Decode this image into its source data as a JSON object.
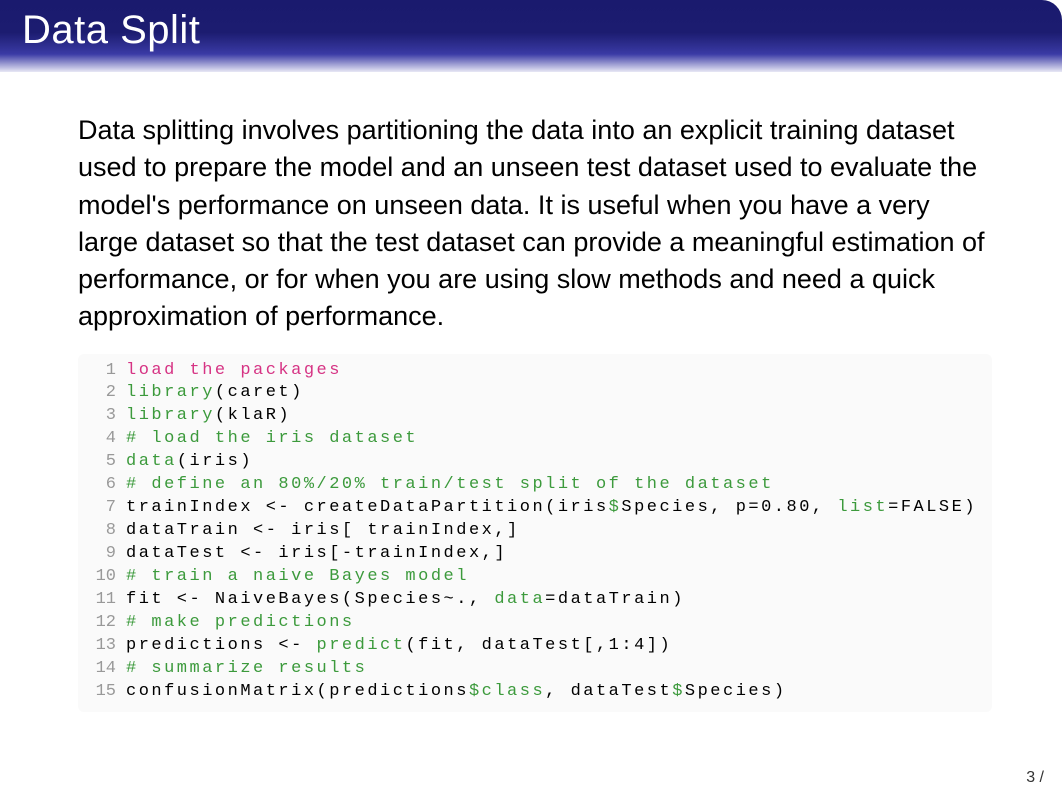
{
  "title": "Data Split",
  "paragraph": "Data splitting involves partitioning the data into an explicit training dataset used to prepare the model and an unseen test dataset used to evaluate the model's performance on unseen data. It is useful when you have a very large dataset so that the test dataset can provide a meaningful estimation of performance, or for when you are using slow methods and need a quick approximation of performance.",
  "code": {
    "lines": [
      {
        "n": "1",
        "segs": [
          {
            "t": "load the packages",
            "c": "c-magenta"
          }
        ]
      },
      {
        "n": "2",
        "segs": [
          {
            "t": "library",
            "c": "c-green"
          },
          {
            "t": "(caret)",
            "c": "c-black"
          }
        ]
      },
      {
        "n": "3",
        "segs": [
          {
            "t": "library",
            "c": "c-green"
          },
          {
            "t": "(klaR)",
            "c": "c-black"
          }
        ]
      },
      {
        "n": "4",
        "segs": [
          {
            "t": "# load the iris dataset",
            "c": "c-green"
          }
        ]
      },
      {
        "n": "5",
        "segs": [
          {
            "t": "data",
            "c": "c-green"
          },
          {
            "t": "(iris)",
            "c": "c-black"
          }
        ]
      },
      {
        "n": "6",
        "segs": [
          {
            "t": "# define an 80%/20% train/test split of the dataset",
            "c": "c-green"
          }
        ]
      },
      {
        "n": "7",
        "segs": [
          {
            "t": "trainIndex <- createDataPartition(iris",
            "c": "c-black"
          },
          {
            "t": "$",
            "c": "c-green"
          },
          {
            "t": "Species, p=0.80, ",
            "c": "c-black"
          },
          {
            "t": "list",
            "c": "c-green"
          },
          {
            "t": "=FALSE)",
            "c": "c-black"
          }
        ]
      },
      {
        "n": "8",
        "segs": [
          {
            "t": "dataTrain <- iris[ trainIndex,]",
            "c": "c-black"
          }
        ]
      },
      {
        "n": "9",
        "segs": [
          {
            "t": "dataTest <- iris[-trainIndex,]",
            "c": "c-black"
          }
        ]
      },
      {
        "n": "10",
        "segs": [
          {
            "t": "# train a naive Bayes model",
            "c": "c-green"
          }
        ]
      },
      {
        "n": "11",
        "segs": [
          {
            "t": "fit <- NaiveBayes(Species~., ",
            "c": "c-black"
          },
          {
            "t": "data",
            "c": "c-green"
          },
          {
            "t": "=dataTrain)",
            "c": "c-black"
          }
        ]
      },
      {
        "n": "12",
        "segs": [
          {
            "t": "# make predictions",
            "c": "c-green"
          }
        ]
      },
      {
        "n": "13",
        "segs": [
          {
            "t": "predictions <- ",
            "c": "c-black"
          },
          {
            "t": "predict",
            "c": "c-green"
          },
          {
            "t": "(fit, dataTest[,1:4])",
            "c": "c-black"
          }
        ]
      },
      {
        "n": "14",
        "segs": [
          {
            "t": "# summarize results",
            "c": "c-green"
          }
        ]
      },
      {
        "n": "15",
        "segs": [
          {
            "t": "confusionMatrix(predictions",
            "c": "c-black"
          },
          {
            "t": "$class",
            "c": "c-green"
          },
          {
            "t": ", dataTest",
            "c": "c-black"
          },
          {
            "t": "$",
            "c": "c-green"
          },
          {
            "t": "Species)",
            "c": "c-black"
          }
        ]
      }
    ]
  },
  "footer": "3 /"
}
